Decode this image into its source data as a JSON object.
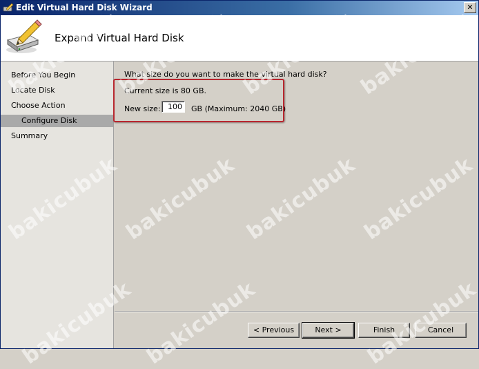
{
  "window": {
    "title": "Edit Virtual Hard Disk Wizard",
    "close_label": "✕"
  },
  "header": {
    "title": "Expand Virtual Hard Disk"
  },
  "sidebar": {
    "items": [
      {
        "label": "Before You Begin"
      },
      {
        "label": "Locate Disk"
      },
      {
        "label": "Choose Action"
      },
      {
        "label": "Configure Disk"
      },
      {
        "label": "Summary"
      }
    ]
  },
  "main": {
    "question": "What size do you want to make the virtual hard disk?",
    "current_size": "Current size is 80 GB.",
    "new_size_label": "New size:",
    "new_size_value": "100",
    "unit_text": "GB (Maximum: 2040 GB)"
  },
  "buttons": {
    "previous": "< Previous",
    "next": "Next >",
    "finish": "Finish",
    "cancel": "Cancel"
  },
  "watermark": {
    "text": "bakicubuk"
  },
  "colors": {
    "highlight": "#b8262e",
    "titlebar": "#0a246a",
    "active_nav": "#a9a9a9"
  }
}
